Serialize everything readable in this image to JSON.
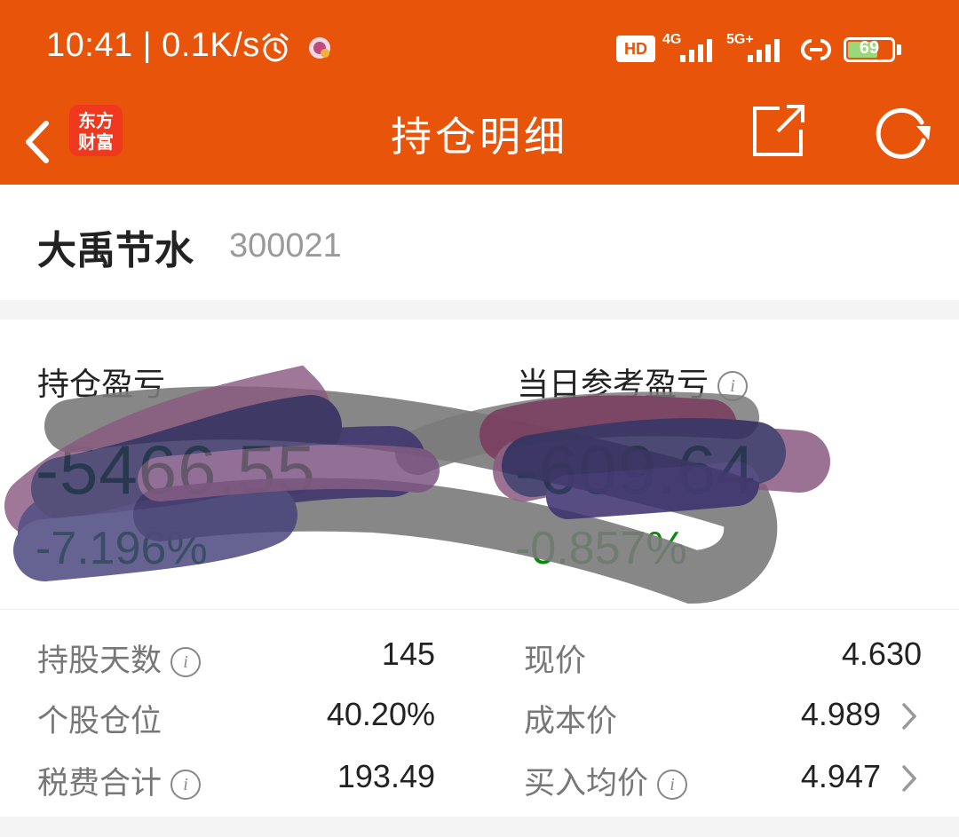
{
  "status_bar": {
    "time_speed": "10:41 | 0.1K/s",
    "hd_label": "HD",
    "net1": "4G",
    "net2": "5G+",
    "battery": "69",
    "battery_level": 0.69
  },
  "nav": {
    "logo_line1": "东方",
    "logo_line2": "财富",
    "title": "持仓明细"
  },
  "stock": {
    "name": "大禹节水",
    "code": "300021"
  },
  "pnl": {
    "position_label": "持仓盈亏",
    "position_amount": "-5466.55",
    "position_pct": "-7.196%",
    "daily_label": "当日参考盈亏",
    "daily_amount": "-609.64",
    "daily_pct": "-0.857%"
  },
  "details": {
    "left": [
      {
        "label": "持股天数",
        "value": "145",
        "info": true
      },
      {
        "label": "个股仓位",
        "value": "40.20%",
        "info": false
      },
      {
        "label": "税费合计",
        "value": "193.49",
        "info": true
      }
    ],
    "right": [
      {
        "label": "现价",
        "value": "4.630",
        "info": false,
        "chevron": false
      },
      {
        "label": "成本价",
        "value": "4.989",
        "info": false,
        "chevron": true
      },
      {
        "label": "买入均价",
        "value": "4.947",
        "info": true,
        "chevron": true
      }
    ]
  },
  "colors": {
    "brand": "#e8540a",
    "loss_green": "#0a8a0a",
    "scribble_purple": "#3a2f6e",
    "scribble_gray": "#7a7a7a"
  },
  "icons": [
    "alarm-icon",
    "app-notif-icon",
    "signal-icon",
    "link-icon",
    "battery-icon",
    "back-icon",
    "share-icon",
    "refresh-icon",
    "info-icon",
    "chevron-right-icon"
  ]
}
